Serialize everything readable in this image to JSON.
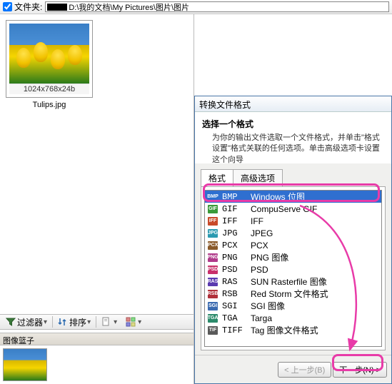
{
  "folderBar": {
    "label": "文件夹:",
    "path": "D:\\我的文档\\My Pictures\\图片\\图片"
  },
  "thumbnail": {
    "dimensions": "1024x768x24b",
    "filename": "Tulips.jpg"
  },
  "toolbar": {
    "filter": "过滤器",
    "sort": "排序"
  },
  "basket": {
    "title": "图像篮子"
  },
  "wizard": {
    "title": "转换文件格式",
    "heading": "选择一个格式",
    "description": "为你的输出文件选取一个文件格式，并单击\"格式设置\"格式关联的任何选项。单击高级选项卡设置这个向导",
    "tabs": {
      "format": "格式",
      "advanced": "高级选项"
    },
    "buttons": {
      "back": "< 上一步(B)",
      "next": "下一步(N) >"
    },
    "formats": [
      {
        "ext": "BMP",
        "desc": "Windows 位图",
        "color": "#2a6fd0",
        "selected": true
      },
      {
        "ext": "GIF",
        "desc": "CompuServe GIF",
        "color": "#3a9a3a"
      },
      {
        "ext": "IFF",
        "desc": "IFF",
        "color": "#c94a2a"
      },
      {
        "ext": "JPG",
        "desc": "JPEG",
        "color": "#2a9ab0"
      },
      {
        "ext": "PCX",
        "desc": "PCX",
        "color": "#8a5a2a"
      },
      {
        "ext": "PNG",
        "desc": "PNG 图像",
        "color": "#b03a8a"
      },
      {
        "ext": "PSD",
        "desc": "PSD",
        "color": "#c9306a"
      },
      {
        "ext": "RAS",
        "desc": "SUN Rasterfile 图像",
        "color": "#5a3ab0"
      },
      {
        "ext": "RSB",
        "desc": "Red Storm 文件格式",
        "color": "#b0303a"
      },
      {
        "ext": "SGI",
        "desc": "SGI 图像",
        "color": "#3a6ab0"
      },
      {
        "ext": "TGA",
        "desc": "Targa",
        "color": "#2a8a6a"
      },
      {
        "ext": "TIFF",
        "desc": "Tag 图像文件格式",
        "color": "#5a5a5a"
      }
    ]
  }
}
